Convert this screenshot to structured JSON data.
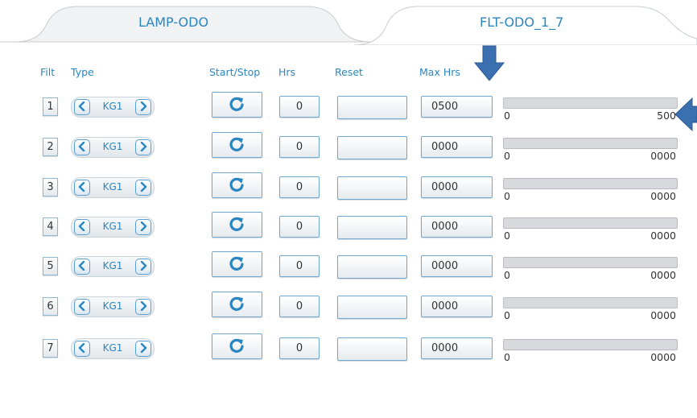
{
  "tabs": [
    {
      "label": "LAMP-ODO",
      "active": false
    },
    {
      "label": "FLT-ODO_1_7",
      "active": true
    }
  ],
  "headers": {
    "filt": "Filt",
    "type": "Type",
    "start_stop": "Start/Stop",
    "hrs": "Hrs",
    "reset": "Reset",
    "max_hrs": "Max Hrs"
  },
  "rows": [
    {
      "filt": "1",
      "type": "KG1",
      "hrs": "0",
      "reset": "",
      "max_hrs": "0500",
      "bar_min": "0",
      "bar_max": "500",
      "progress_fraction": 0
    },
    {
      "filt": "2",
      "type": "KG1",
      "hrs": "0",
      "reset": "",
      "max_hrs": "0000",
      "bar_min": "0",
      "bar_max": "0000",
      "progress_fraction": 0
    },
    {
      "filt": "3",
      "type": "KG1",
      "hrs": "0",
      "reset": "",
      "max_hrs": "0000",
      "bar_min": "0",
      "bar_max": "0000",
      "progress_fraction": 0
    },
    {
      "filt": "4",
      "type": "KG1",
      "hrs": "0",
      "reset": "",
      "max_hrs": "0000",
      "bar_min": "0",
      "bar_max": "0000",
      "progress_fraction": 0
    },
    {
      "filt": "5",
      "type": "KG1",
      "hrs": "0",
      "reset": "",
      "max_hrs": "0000",
      "bar_min": "0",
      "bar_max": "0000",
      "progress_fraction": 0
    },
    {
      "filt": "6",
      "type": "KG1",
      "hrs": "0",
      "reset": "",
      "max_hrs": "0000",
      "bar_min": "0",
      "bar_max": "0000",
      "progress_fraction": 0
    },
    {
      "filt": "7",
      "type": "KG1",
      "hrs": "0",
      "reset": "",
      "max_hrs": "0000",
      "bar_min": "0",
      "bar_max": "0000",
      "progress_fraction": 0
    }
  ],
  "icons": {
    "prev": "chevron-left-icon",
    "next": "chevron-right-icon",
    "start_stop": "refresh-icon",
    "annotation_down": "arrow-down-icon",
    "annotation_left": "arrow-left-icon"
  },
  "colors": {
    "accent": "#2a86c0",
    "annotation_arrow": "#3a6fb0",
    "bar_track": "#d7d9dc"
  }
}
